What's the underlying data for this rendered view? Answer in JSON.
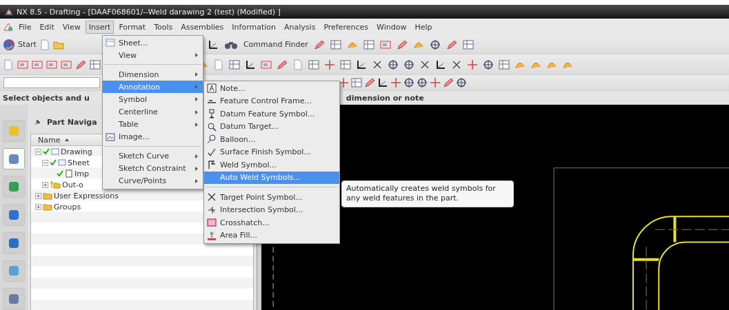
{
  "window": {
    "title": "NX 8.5 - Drafting - [DAAF068601/--Weld darawing 2 (test) (Modified) ]"
  },
  "menu_bar": [
    {
      "label": "File",
      "selected": false
    },
    {
      "label": "Edit",
      "selected": false
    },
    {
      "label": "View",
      "selected": false
    },
    {
      "label": "Insert",
      "selected": true
    },
    {
      "label": "Format",
      "selected": false
    },
    {
      "label": "Tools",
      "selected": false
    },
    {
      "label": "Assemblies",
      "selected": false
    },
    {
      "label": "Information",
      "selected": false
    },
    {
      "label": "Analysis",
      "selected": false
    },
    {
      "label": "Preferences",
      "selected": false
    },
    {
      "label": "Window",
      "selected": false
    },
    {
      "label": "Help",
      "selected": false
    }
  ],
  "toolbar": {
    "start_label": "Start",
    "command_finder_label": "Command Finder"
  },
  "cue_line": {
    "prompt": "Select objects and u",
    "prompt_end": "dimension or note"
  },
  "resource_bar": [
    {
      "selected": false
    },
    {
      "selected": true
    },
    {
      "selected": false
    },
    {
      "selected": false
    },
    {
      "selected": false
    },
    {
      "selected": false
    },
    {
      "selected": false
    }
  ],
  "part_navigator": {
    "title": "Part Naviga",
    "column": "Name",
    "tree": [
      {
        "label": "Drawing",
        "kind": "drawing",
        "checked": true,
        "expanded": true,
        "children": [
          {
            "label": "Sheet",
            "kind": "sheet",
            "checked": true,
            "expanded": true,
            "children": [
              {
                "label": "Imp",
                "kind": "view",
                "checked": true
              }
            ]
          },
          {
            "label": "Out-o",
            "kind": "key-folder",
            "checked": false,
            "expanded": false
          }
        ]
      },
      {
        "label": "User Expressions",
        "kind": "folder",
        "checked": false,
        "expanded": false
      },
      {
        "label": "Groups",
        "kind": "folder",
        "checked": false,
        "expanded": false
      }
    ]
  },
  "insert_menu": [
    {
      "kind": "item",
      "label": "Sheet...",
      "submenu": false,
      "selected": false
    },
    {
      "kind": "item",
      "label": "View",
      "submenu": true,
      "selected": false
    },
    {
      "kind": "separator"
    },
    {
      "kind": "item",
      "label": "Dimension",
      "submenu": true,
      "selected": false
    },
    {
      "kind": "item",
      "label": "Annotation",
      "submenu": true,
      "selected": true
    },
    {
      "kind": "item",
      "label": "Symbol",
      "submenu": true,
      "selected": false
    },
    {
      "kind": "item",
      "label": "Centerline",
      "submenu": true,
      "selected": false
    },
    {
      "kind": "item",
      "label": "Table",
      "submenu": true,
      "selected": false
    },
    {
      "kind": "item",
      "label": "Image...",
      "submenu": false,
      "selected": false
    },
    {
      "kind": "separator"
    },
    {
      "kind": "item",
      "label": "Sketch Curve",
      "submenu": true,
      "selected": false
    },
    {
      "kind": "item",
      "label": "Sketch Constraint",
      "submenu": true,
      "selected": false
    },
    {
      "kind": "item",
      "label": "Curve/Points",
      "submenu": true,
      "selected": false
    }
  ],
  "annotation_menu": [
    {
      "kind": "item",
      "label": "Note...",
      "selected": false
    },
    {
      "kind": "item",
      "label": "Feature Control Frame...",
      "selected": false
    },
    {
      "kind": "item",
      "label": "Datum Feature Symbol...",
      "selected": false
    },
    {
      "kind": "item",
      "label": "Datum Target...",
      "selected": false
    },
    {
      "kind": "item",
      "label": "Balloon...",
      "selected": false
    },
    {
      "kind": "item",
      "label": "Surface Finish Symbol...",
      "selected": false
    },
    {
      "kind": "item",
      "label": "Weld Symbol...",
      "selected": false
    },
    {
      "kind": "item",
      "label": "Auto Weld Symbols...",
      "selected": true
    },
    {
      "kind": "separator"
    },
    {
      "kind": "item",
      "label": "Target Point Symbol...",
      "selected": false
    },
    {
      "kind": "item",
      "label": "Intersection Symbol...",
      "selected": false
    },
    {
      "kind": "item",
      "label": "Crosshatch...",
      "selected": false
    },
    {
      "kind": "item",
      "label": "Area Fill...",
      "selected": false
    }
  ],
  "tooltip": "Automatically creates weld symbols for any weld features in the part."
}
